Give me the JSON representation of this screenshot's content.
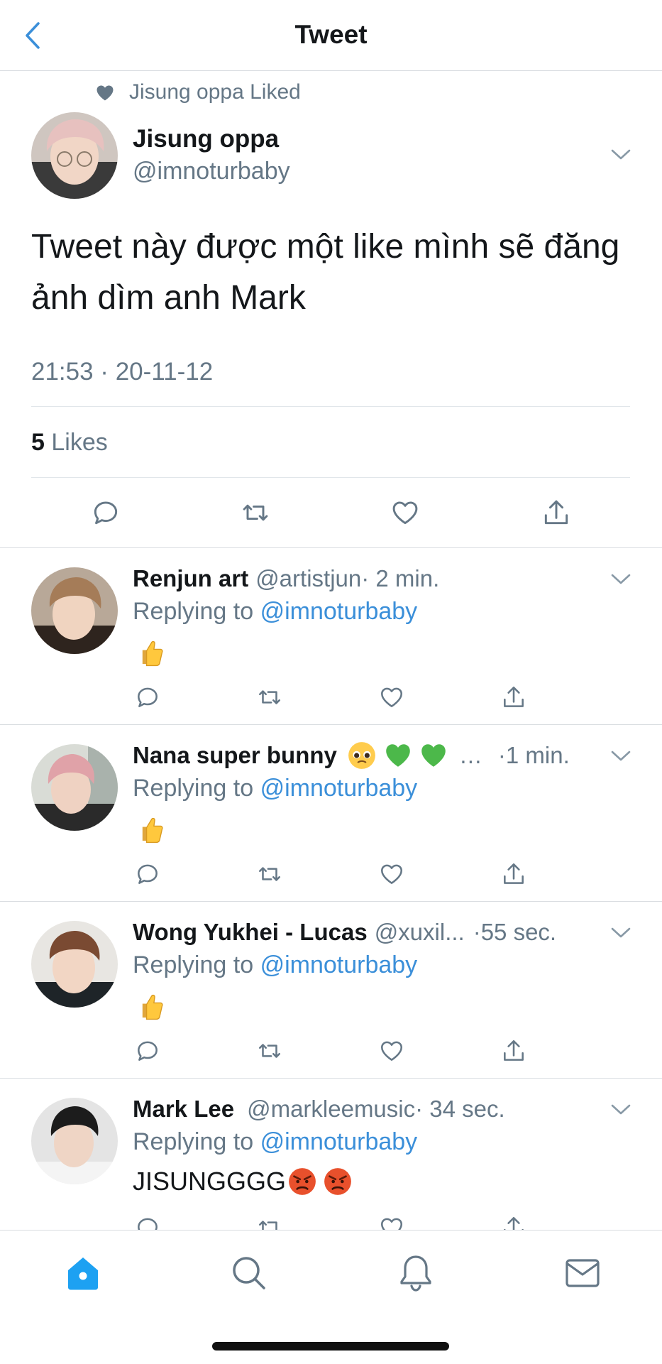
{
  "header": {
    "title": "Tweet",
    "back_icon": "chevron-left-icon"
  },
  "social_context": {
    "icon": "heart-filled-icon",
    "text": "Jisung oppa Liked"
  },
  "tweet": {
    "author_name": "Jisung oppa",
    "author_handle": "@imnoturbaby",
    "text": "Tweet này được một like mình sẽ đăng ảnh dìm anh Mark",
    "timestamp": "21:53 · 20-11-12",
    "likes_count": "5",
    "likes_label": "Likes",
    "actions": [
      "reply-icon",
      "retweet-icon",
      "like-icon",
      "share-icon"
    ]
  },
  "replies": [
    {
      "name": "Renjun art",
      "handle": "@artistjun",
      "time": "· 2 min.",
      "replying_prefix": "Replying to",
      "mention": "@imnoturbaby",
      "body_text": "",
      "body_emojis": [
        "thumbs-up-emoji"
      ]
    },
    {
      "name": "Nana super bunny",
      "handle": "…",
      "time": "·1 min.",
      "name_emojis": [
        "pleading-face-emoji",
        "green-heart-emoji",
        "green-heart-emoji"
      ],
      "replying_prefix": "Replying to",
      "mention": "@imnoturbaby",
      "body_text": "",
      "body_emojis": [
        "thumbs-up-emoji"
      ]
    },
    {
      "name": "Wong Yukhei - Lucas",
      "handle": "@xuxil...",
      "time": "·55 sec.",
      "replying_prefix": "Replying to",
      "mention": "@imnoturbaby",
      "body_text": "",
      "body_emojis": [
        "thumbs-up-emoji"
      ]
    },
    {
      "name": "Mark Lee",
      "handle": "@markleemusic",
      "time": "· 34 sec.",
      "replying_prefix": "Replying to",
      "mention": "@imnoturbaby",
      "body_text": "JISUNGGGG",
      "body_emojis": [
        "angry-face-emoji",
        "angry-face-emoji"
      ]
    }
  ],
  "tabbar": {
    "items": [
      "home-icon",
      "search-icon",
      "notifications-icon",
      "messages-icon"
    ],
    "active": "home-icon"
  },
  "colors": {
    "accent": "#1da1f2",
    "link": "#3b8fd9",
    "secondary_text": "#657786",
    "divider": "#e1e6ea"
  }
}
